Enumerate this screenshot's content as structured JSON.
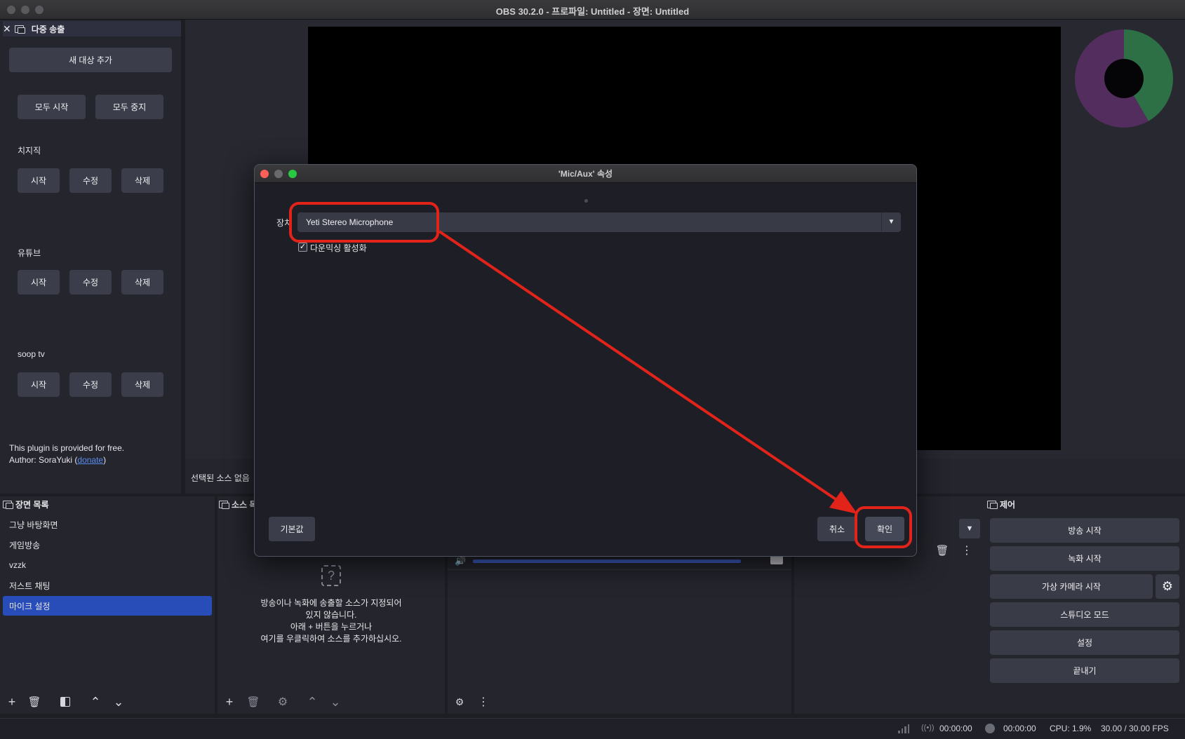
{
  "window": {
    "title": "OBS 30.2.0 - 프로파일: Untitled - 장면: Untitled"
  },
  "multistream": {
    "title": "다중 송출",
    "add_target": "새 대상 추가",
    "start_all": "모두 시작",
    "stop_all": "모두 중지",
    "targets": [
      {
        "name": "치지직",
        "start": "시작",
        "edit": "수정",
        "delete": "삭제"
      },
      {
        "name": "유튜브",
        "start": "시작",
        "edit": "수정",
        "delete": "삭제"
      },
      {
        "name": "soop tv",
        "start": "시작",
        "edit": "수정",
        "delete": "삭제"
      }
    ],
    "footer_line1": "This plugin is provided for free.",
    "footer_author_prefix": "Author: SoraYuki (",
    "footer_link": "donate",
    "footer_author_suffix": ")"
  },
  "preview": {
    "no_source": "선택된 소스 없음"
  },
  "scenes": {
    "title": "장면 목록",
    "items": [
      "그냥 바탕화면",
      "게임방송",
      "vzzk",
      "저스트 채팅",
      "마이크 설정"
    ],
    "selected_index": 4
  },
  "sources": {
    "title": "소스 목록",
    "empty_lines": [
      "방송이나 녹화에 송출할 소스가 지정되어",
      "있지 않습니다.",
      "아래 + 버튼을 누르거나",
      "여기를 우클릭하여 소스를 추가하십시오."
    ]
  },
  "controls": {
    "title": "제어",
    "start_stream": "방송 시작",
    "start_record": "녹화 시작",
    "start_vcam": "가상 카메라 시작",
    "studio_mode": "스튜디오 모드",
    "settings": "설정",
    "exit": "끝내기"
  },
  "dialog": {
    "title": "'Mic/Aux' 속성",
    "device_label": "장치",
    "device_value": "Yeti Stereo Microphone",
    "downmix_label": "다운믹싱 활성화",
    "downmix_checked": true,
    "defaults": "기본값",
    "cancel": "취소",
    "ok": "확인"
  },
  "status": {
    "stream_time": "00:00:00",
    "record_time": "00:00:00",
    "cpu": "CPU: 1.9%",
    "fps": "30.00 / 30.00 FPS"
  },
  "colors": {
    "accent_selected": "#284cb8",
    "annotation": "#e2231a",
    "link": "#5a8dee"
  }
}
